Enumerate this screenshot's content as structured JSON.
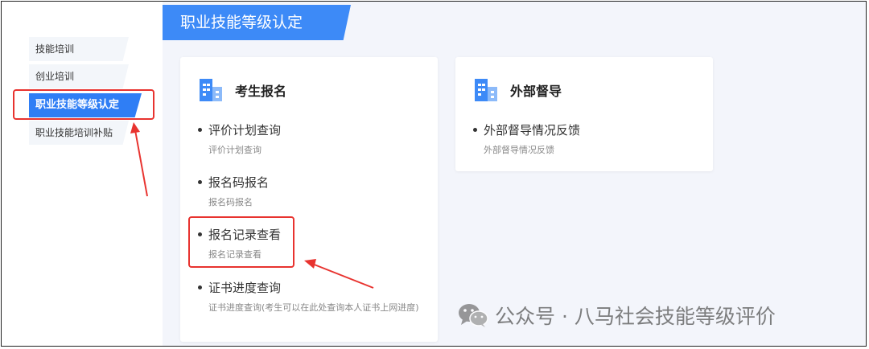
{
  "sidebar": {
    "items": [
      {
        "label": "技能培训"
      },
      {
        "label": "创业培训"
      },
      {
        "label": "职业技能等级认定"
      },
      {
        "label": "职业技能培训补贴"
      }
    ]
  },
  "main": {
    "page_title": "职业技能等级认定",
    "cards": [
      {
        "title": "考生报名",
        "icon": "building-icon",
        "entries": [
          {
            "title": "评价计划查询",
            "desc": "评价计划查询"
          },
          {
            "title": "报名码报名",
            "desc": "报名码报名"
          },
          {
            "title": "报名记录查看",
            "desc": "报名记录查看"
          },
          {
            "title": "证书进度查询",
            "desc": "证书进度查询(考生可以在此处查询本人证书上网进度)"
          }
        ]
      },
      {
        "title": "外部督导",
        "icon": "building-icon",
        "entries": [
          {
            "title": "外部督导情况反馈",
            "desc": "外部督导情况反馈"
          }
        ]
      }
    ]
  },
  "watermark": {
    "text": "公众号 · 八马社会技能等级评价",
    "icon": "wechat-icon"
  },
  "colors": {
    "accent": "#3d8af7",
    "annotation": "#e8332f",
    "background": "#f3f5fb"
  }
}
